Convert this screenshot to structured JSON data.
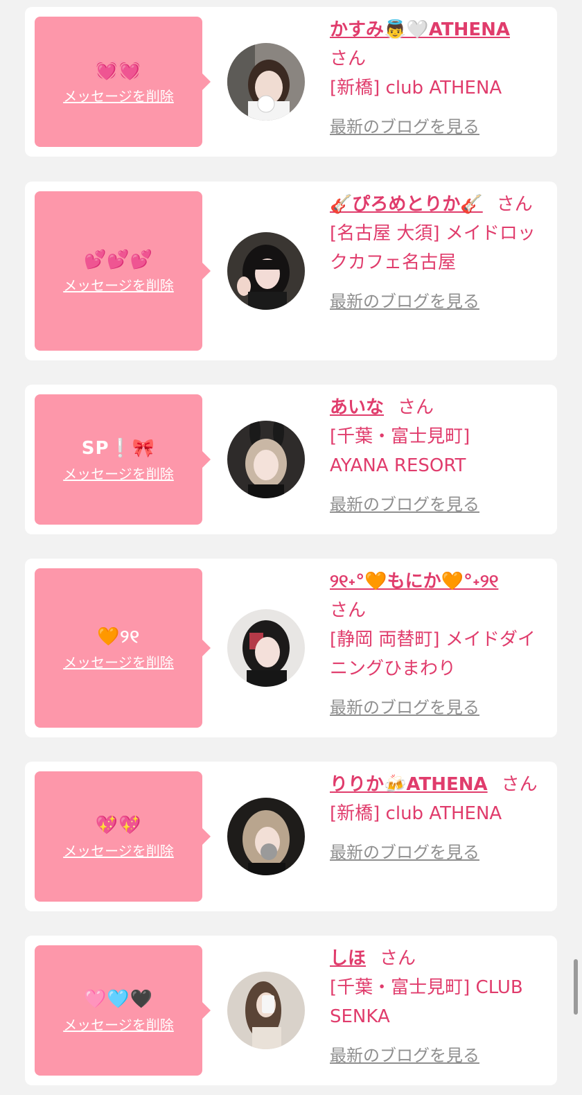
{
  "cards": [
    {
      "message": "💓💓",
      "delete_label": "メッセージを削除",
      "name": "かすみ👼🤍ATHENA",
      "suffix": "さん",
      "shop": "[新橋] club ATHENA",
      "blog_label": "最新のブログを見る"
    },
    {
      "message": "💕💕💕",
      "delete_label": "メッセージを削除",
      "name": "🎸ぴろめとりか🎸",
      "suffix": "さん",
      "shop": "[名古屋 大須] メイドロックカフェ名古屋",
      "blog_label": "最新のブログを見る"
    },
    {
      "message": "SP❕🎀",
      "delete_label": "メッセージを削除",
      "name": "あいな",
      "suffix": "さん",
      "shop": "[千葉・富士見町] AYANA RESORT",
      "blog_label": "最新のブログを見る"
    },
    {
      "message": "🧡୨୧",
      "delete_label": "メッセージを削除",
      "name": "୨୧˖°🧡もにか🧡°˖୨୧",
      "suffix": "さん",
      "shop": "[静岡 両替町] メイドダイニングひまわり",
      "blog_label": "最新のブログを見る"
    },
    {
      "message": "💖💖",
      "delete_label": "メッセージを削除",
      "name": "りりか🍻ATHENA",
      "suffix": "さん",
      "shop": "[新橋] club ATHENA",
      "blog_label": "最新のブログを見る"
    },
    {
      "message": "🩷🩵🖤",
      "delete_label": "メッセージを削除",
      "name": "しほ",
      "suffix": "さん",
      "shop": "[千葉・富士見町] CLUB SENKA",
      "blog_label": "最新のブログを見る"
    }
  ]
}
